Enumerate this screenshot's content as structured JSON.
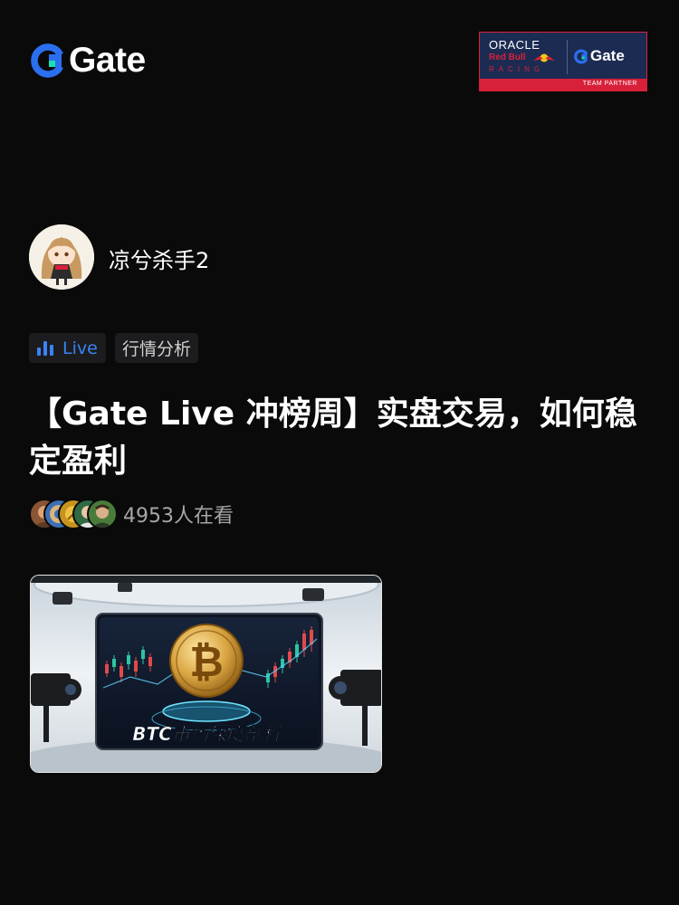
{
  "brand": {
    "logo_text": "Gate",
    "logo_icon": "gate-logo-icon",
    "accent": "#2a6ff0"
  },
  "partner_badge": {
    "oracle": "ORACLE",
    "redbull": "Red Bull",
    "racing": "RACING",
    "gate": "Gate",
    "strip": "TEAM PARTNER"
  },
  "streamer": {
    "name": "凉兮杀手2",
    "avatar": "anime-girl-avatar"
  },
  "tags": {
    "live": "Live",
    "category": "行情分析"
  },
  "stream": {
    "title": "【Gate Live 冲榜周】实盘交易，如何稳定盈利",
    "viewers": "4953人在看",
    "thumbnail_caption": "BTC市场深度剖析"
  },
  "colors": {
    "background": "#0a0a0a",
    "live": "#3b82f6",
    "tag_bg": "#1c1c1e",
    "muted": "#a6a6a6"
  }
}
